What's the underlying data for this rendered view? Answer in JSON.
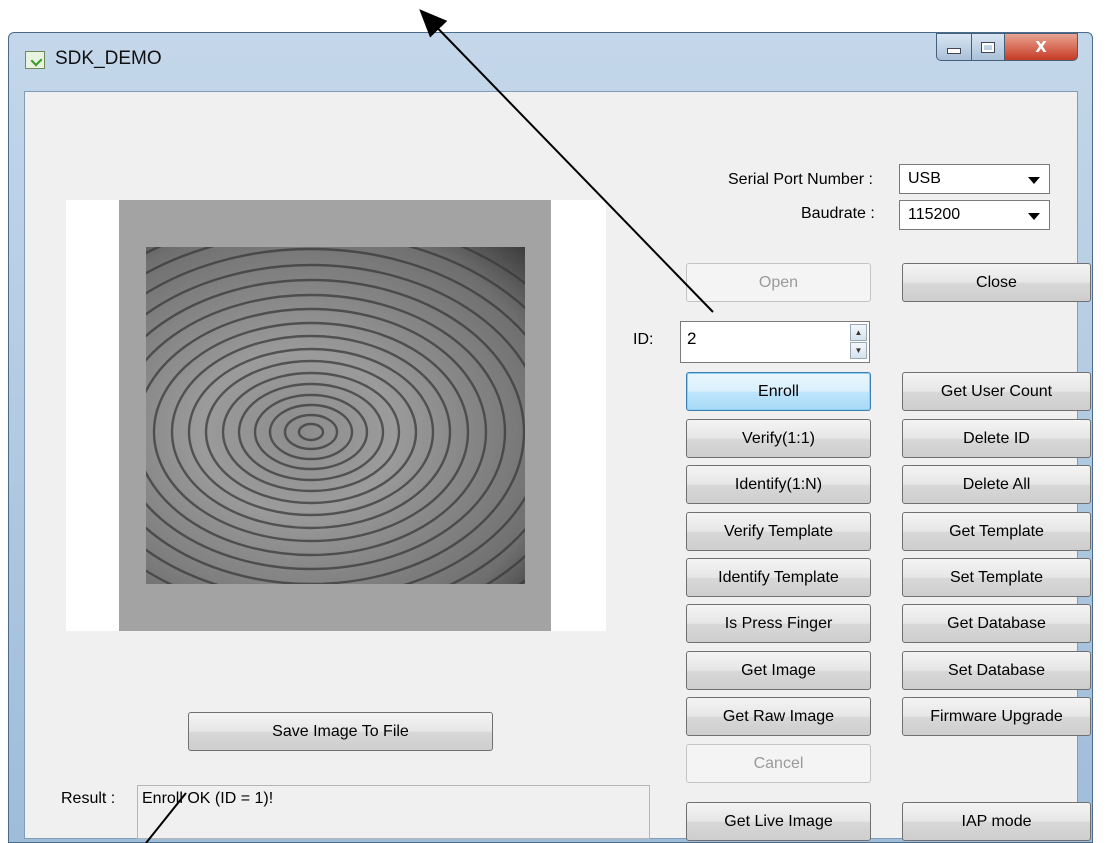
{
  "window": {
    "title": "SDK_DEMO",
    "minimize_glyph": "",
    "maximize_glyph": "",
    "close_glyph": "X"
  },
  "connection": {
    "serial_port_label": "Serial Port Number :",
    "serial_port_value": "USB",
    "baudrate_label": "Baudrate :",
    "baudrate_value": "115200",
    "open_label": "Open",
    "close_label": "Close"
  },
  "id_field": {
    "label": "ID:",
    "value": "2"
  },
  "actions_left": [
    "Enroll",
    "Verify(1:1)",
    "Identify(1:N)",
    "Verify Template",
    "Identify Template",
    "Is Press Finger",
    "Get Image",
    "Get Raw Image",
    "Cancel",
    "Get Live Image"
  ],
  "actions_right": [
    "Get User Count",
    "Delete ID",
    "Delete All",
    "Get Template",
    "Set Template",
    "Get Database",
    "Set Database",
    "Firmware Upgrade",
    "IAP mode"
  ],
  "image_panel": {
    "save_label": "Save Image To File"
  },
  "result": {
    "label": "Result :",
    "text": "Enroll OK (ID = 1)!"
  }
}
